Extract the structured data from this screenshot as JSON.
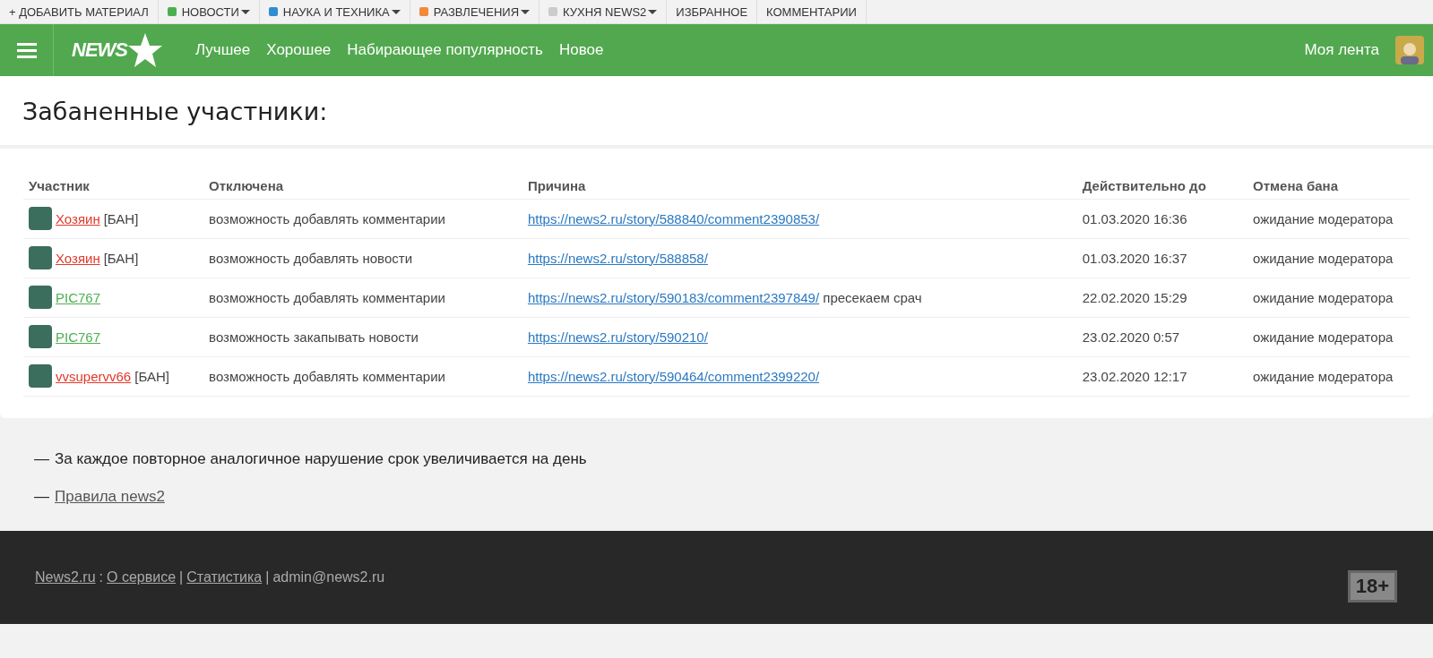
{
  "top_menu": [
    {
      "label": "+ ДОБАВИТЬ МАТЕРИАЛ",
      "has_menu": false
    },
    {
      "label": "НОВОСТИ",
      "color": "#4caf50",
      "has_menu": true
    },
    {
      "label": "НАУКА И ТЕХНИКА",
      "color": "#2f8ecf",
      "has_menu": true
    },
    {
      "label": "РАЗВЛЕЧЕНИЯ",
      "color": "#f08a3c",
      "has_menu": true
    },
    {
      "label": "КУХНЯ NEWS2",
      "color": "#cccccc",
      "has_menu": true
    },
    {
      "label": "ИЗБРАННОЕ",
      "has_menu": false
    },
    {
      "label": "КОММЕНТАРИИ",
      "has_menu": false
    }
  ],
  "header": {
    "logo": "NEWS",
    "nav": [
      "Лучшее",
      "Хорошее",
      "Набирающее популярность",
      "Новое"
    ],
    "my_feed": "Моя лента"
  },
  "page_title": "Забаненные участники:",
  "table": {
    "columns": [
      "Участник",
      "Отключена",
      "Причина",
      "Действительно до",
      "Отмена бана"
    ],
    "rows": [
      {
        "user": "Хозяин",
        "color": "#e0392b",
        "tag": "[БАН]",
        "disabled": "возможность добавлять комментарии",
        "link": "https://news2.ru/story/588840/comment2390853/",
        "until": "01.03.2020 16:36",
        "cancel": "ожидание модератора"
      },
      {
        "user": "Хозяин",
        "color": "#e0392b",
        "tag": "[БАН]",
        "disabled": "возможность добавлять новости",
        "link": "https://news2.ru/story/588858/",
        "until": "01.03.2020 16:37",
        "cancel": "ожидание модератора"
      },
      {
        "user": "PIC767",
        "color": "#4caf50",
        "disabled": "возможность добавлять комментарии",
        "link": "https://news2.ru/story/590183/comment2397849/",
        "note": "пресекаем срач",
        "until": "22.02.2020 15:29",
        "cancel": "ожидание модератора"
      },
      {
        "user": "PIC767",
        "color": "#4caf50",
        "disabled": "возможность закапывать новости",
        "link": "https://news2.ru/story/590210/",
        "until": "23.02.2020 0:57",
        "cancel": "ожидание модератора"
      },
      {
        "user": "vvsupervv66",
        "color": "#e0392b",
        "tag": "[БАН]",
        "disabled": "возможность добавлять комментарии",
        "link": "https://news2.ru/story/590464/comment2399220/",
        "until": "23.02.2020 12:17",
        "cancel": "ожидание модератора"
      }
    ]
  },
  "notes": [
    {
      "dash": "—",
      "text": "За каждое повторное аналогичное нарушение срок увеличивается на день"
    },
    {
      "dash": "—",
      "link": "Правила news2"
    }
  ],
  "footer": {
    "site": "News2.ru",
    "sep": ":",
    "about": "О сервисе",
    "bar1": "|",
    "stats": "Статистика",
    "bar2": "|",
    "email": "admin@news2.ru",
    "age": "18+"
  }
}
